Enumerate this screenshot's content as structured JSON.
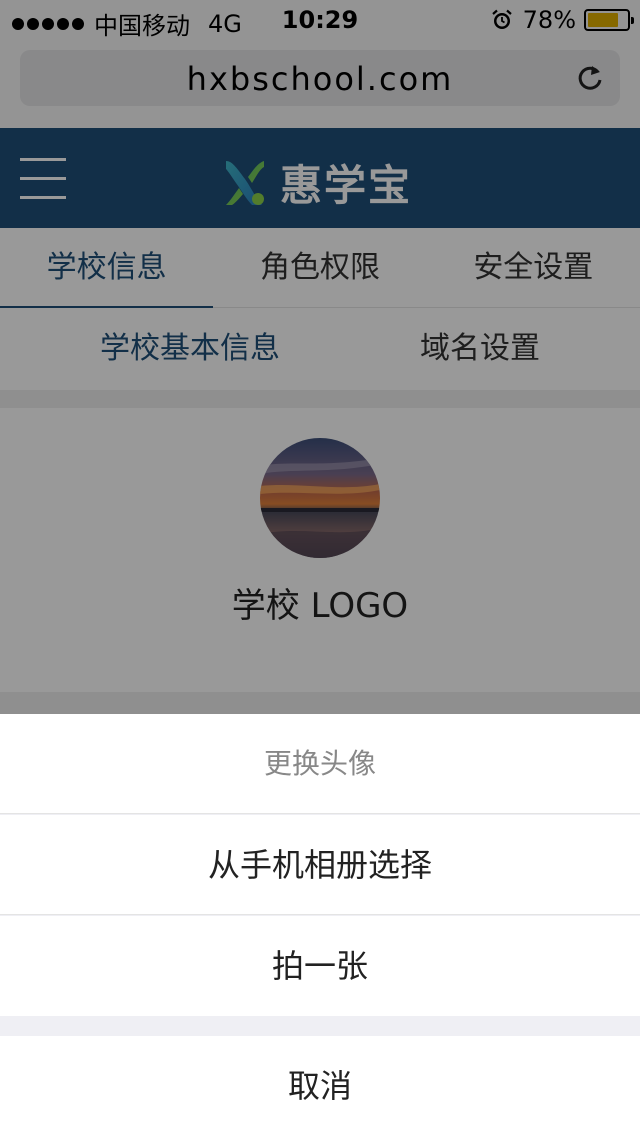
{
  "status_bar": {
    "carrier": "中国移动",
    "network": "4G",
    "time": "10:29",
    "battery_percent": "78%",
    "battery_level": 0.78,
    "signal_icon": "signal-dots-icon",
    "alarm_icon": "alarm-clock-icon"
  },
  "browser": {
    "url": "hxbschool.com",
    "reload_icon": "reload-icon"
  },
  "header": {
    "brand": "惠学宝",
    "menu_icon": "hamburger-menu-icon",
    "brand_color": "#1e4f78"
  },
  "tabs": [
    {
      "label": "学校信息",
      "active": true
    },
    {
      "label": "角色权限",
      "active": false
    },
    {
      "label": "安全设置",
      "active": false
    }
  ],
  "subtabs": [
    {
      "label": "学校基本信息",
      "active": true
    },
    {
      "label": "域名设置",
      "active": false
    }
  ],
  "logo_section": {
    "label": "学校 LOGO"
  },
  "action_sheet": {
    "title": "更换头像",
    "options": [
      {
        "label": "从手机相册选择"
      },
      {
        "label": "拍一张"
      }
    ],
    "cancel": "取消"
  }
}
